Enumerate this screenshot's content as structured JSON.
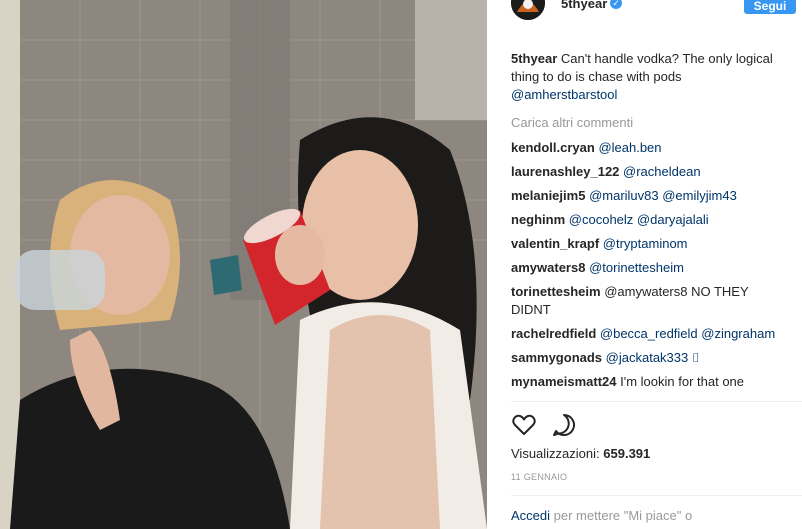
{
  "post": {
    "username": "5thyear",
    "follow_label": "Segui",
    "caption_user": "5thyear",
    "caption_text": "Can't handle vodka? The only logical thing to do is chase with pods",
    "caption_mention": "@amherstbarstool"
  },
  "load_more": "Carica altri commenti",
  "comments": [
    {
      "user": "kendoll.cryan",
      "text": "@leah.ben"
    },
    {
      "user": "laurenashley_122",
      "text": "@racheldean"
    },
    {
      "user": "melaniejim5",
      "text": "@mariluv83 @emilyjim43"
    },
    {
      "user": "neghinm",
      "text": "@cocohelz @daryajalali"
    },
    {
      "user": "valentin_krapf",
      "text": "@tryptaminom"
    },
    {
      "user": "amywaters8",
      "text": "@torinettesheim"
    },
    {
      "user": "torinettesheim",
      "text": "@amywaters8 NO THEY DIDNT"
    },
    {
      "user": "rachelredfield",
      "text": "@becca_redfield @zingraham"
    },
    {
      "user": "sammygonads",
      "text": "@jackatak333 ⌷"
    },
    {
      "user": "mynameismatt24",
      "text": "I'm lookin for that one"
    }
  ],
  "views": {
    "label": "Visualizzazioni:",
    "count": "659.391"
  },
  "date": "11 GENNAIO",
  "login": {
    "link": "Accedi",
    "text": "per mettere \"Mi piace\" o"
  },
  "icons": {
    "like": "heart-icon",
    "comment": "comment-bubble-icon",
    "verified": "verified-badge-icon"
  },
  "colors": {
    "accent": "#3897f0",
    "link": "#003569",
    "muted": "#999999"
  }
}
